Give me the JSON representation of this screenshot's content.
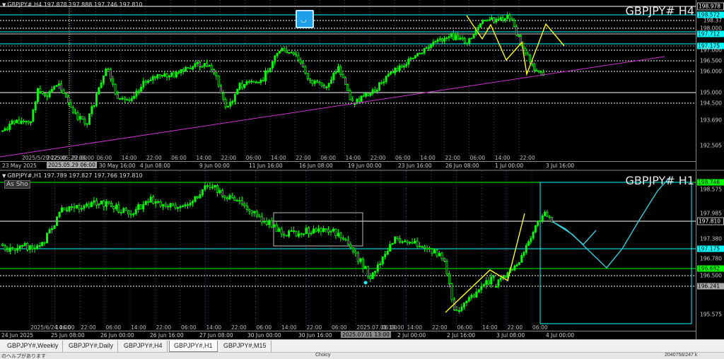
{
  "top_chart": {
    "info_line": "GBPJPY#,H4  197.878 197.888 197.746 197.810",
    "big_title": "GBPJPY#  H4",
    "price_labels": [
      {
        "text": "198.978",
        "style": "box"
      },
      {
        "text": "198.572",
        "style": "cyan"
      },
      {
        "text": "198.37",
        "style": "plain"
      },
      {
        "text": "198.000",
        "style": "plain"
      },
      {
        "text": "197.712",
        "style": "cyan"
      },
      {
        "text": "197.175",
        "style": "cyan"
      },
      {
        "text": "197.000",
        "style": "plain"
      },
      {
        "text": "196.500",
        "style": "plain"
      },
      {
        "text": "196.000",
        "style": "plain"
      },
      {
        "text": "195.000",
        "style": "plain"
      },
      {
        "text": "194.500",
        "style": "plain"
      },
      {
        "text": "193.690",
        "style": "plain"
      },
      {
        "text": "192.505",
        "style": "plain"
      }
    ],
    "time_labels": [
      {
        "text": "23 May 2025",
        "style": "plain"
      },
      {
        "text": "2025.05.29 06:00",
        "style": "hl"
      },
      {
        "text": "30 May 16:00",
        "style": "plain"
      },
      {
        "text": "4 Jun 08:00",
        "style": "plain"
      },
      {
        "text": "9 Jun 00:00",
        "style": "plain"
      },
      {
        "text": "11 Jun 16:00",
        "style": "plain"
      },
      {
        "text": "16 Jun 08:00",
        "style": "plain"
      },
      {
        "text": "19 Jun 00:00",
        "style": "plain"
      },
      {
        "text": "23 Jun 16:00",
        "style": "plain"
      },
      {
        "text": "26 Jun 08:00",
        "style": "plain"
      },
      {
        "text": "1 Jul 00:00",
        "style": "plain"
      },
      {
        "text": "3 Jul 16:00",
        "style": "plain"
      }
    ],
    "grid_time_labels": [
      "2025/5/29 22:00",
      "2025.05.29 06:00",
      "22:00",
      "06:00",
      "14:00",
      "22:00",
      "06:00",
      "14:00",
      "22:00",
      "06:00",
      "14:00",
      "22:00",
      "06:00",
      "14:00",
      "22:00",
      "06:00",
      "14:00",
      "22:00",
      "06:00",
      "14:00",
      "22:00"
    ]
  },
  "bottom_chart": {
    "info_line": "GBPJPY#,H1  197.789 197.827 197.766 197.810",
    "big_title": "GBPJPY#  H1",
    "as_show_label": "As Sho",
    "price_labels": [
      {
        "text": "198.746",
        "style": "green"
      },
      {
        "text": "198.575",
        "style": "plain"
      },
      {
        "text": "197.985",
        "style": "plain"
      },
      {
        "text": "197.810",
        "style": "box"
      },
      {
        "text": "197.380",
        "style": "plain"
      },
      {
        "text": "197.175",
        "style": "cyan"
      },
      {
        "text": "196.780",
        "style": "plain"
      },
      {
        "text": "196.682",
        "style": "green"
      },
      {
        "text": "196.500",
        "style": "plain"
      },
      {
        "text": "196.241",
        "style": "gray"
      },
      {
        "text": "195.575",
        "style": "plain"
      }
    ],
    "time_labels": [
      {
        "text": "24 Jun 2025",
        "style": "plain"
      },
      {
        "text": "25 Jun 08:00",
        "style": "plain"
      },
      {
        "text": "26 Jun 00:00",
        "style": "plain"
      },
      {
        "text": "26 Jun 16:00",
        "style": "plain"
      },
      {
        "text": "27 Jun 08:00",
        "style": "plain"
      },
      {
        "text": "30 Jun 00:00",
        "style": "plain"
      },
      {
        "text": "30 Jun 16:00",
        "style": "plain"
      },
      {
        "text": "2025.07.01 13:00",
        "style": "hl2"
      },
      {
        "text": "2 Jul 00:00",
        "style": "plain"
      },
      {
        "text": "2 Jul 16:00",
        "style": "plain"
      },
      {
        "text": "3 Jul 08:00",
        "style": "plain"
      },
      {
        "text": "4 Jul 00:00",
        "style": "plain"
      }
    ],
    "grid_time_labels": [
      "2025/6/24 06:00",
      "14:00",
      "22:00",
      "06:00",
      "14:00",
      "22:00",
      "06:00",
      "14:00",
      "22:00",
      "06:00",
      "14:00",
      "22:00",
      "06:00",
      "2025.07.01 19:00",
      "06:00",
      "14:00",
      "22:00",
      "06:00",
      "14:00",
      "22:00",
      "06:00"
    ]
  },
  "tabs": [
    {
      "label": "GBPJPY#,Weekly",
      "active": false
    },
    {
      "label": "GBPJPY#,Daily",
      "active": false
    },
    {
      "label": "GBPJPY#,H4",
      "active": false
    },
    {
      "label": "GBPJPY#,H1",
      "active": true
    },
    {
      "label": "GBPJPY#,M15",
      "active": false
    }
  ],
  "status": {
    "left": "のヘルプがあります",
    "mid": "Choicy",
    "right": "2040758/247 k"
  },
  "colors": {
    "candle": "#00ff00",
    "trend_line": "#cc33cc",
    "zigzag": "#ffff00",
    "projection": "#33ccdd",
    "level_cyan": "#00ffff",
    "level_green": "#00ff00"
  }
}
